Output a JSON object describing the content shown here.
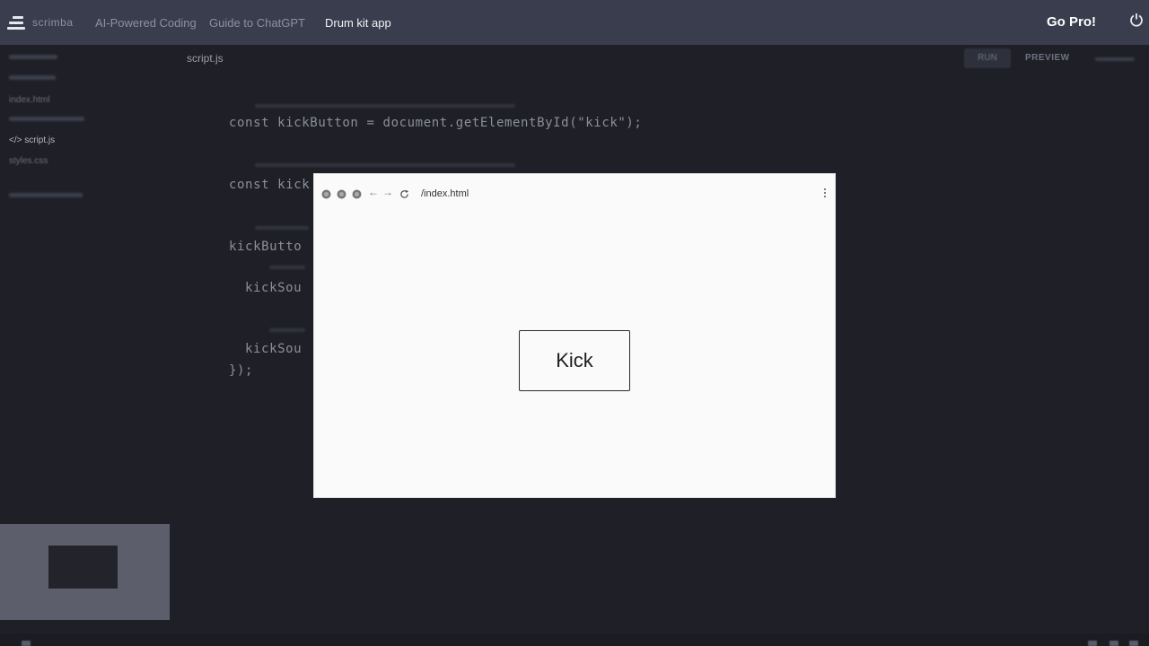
{
  "topbar": {
    "logo_text": "scrimba",
    "breadcrumbs": [
      "AI-Powered Coding",
      "Guide to ChatGPT",
      "Drum kit app"
    ],
    "go_pro": "Go Pro!"
  },
  "sidebar": {
    "files": [
      "index.html",
      "script.js",
      "styles.css"
    ],
    "selected_file": "script.js"
  },
  "editor": {
    "tab_title": "script.js",
    "run_label": "RUN",
    "preview_label": "PREVIEW",
    "lines": [
      "const kickButton = document.getElementById(\"kick\");",
      "const kick",
      "kickButto",
      "kickSou",
      "kickSou",
      "});"
    ]
  },
  "browser": {
    "url": "/index.html",
    "kick_label": "Kick"
  },
  "icons": {
    "logo": "scrimba-logo-icon",
    "power": "power-icon",
    "back": "back-arrow-icon",
    "forward": "forward-arrow-icon",
    "reload": "reload-icon",
    "menu": "kebab-menu-icon"
  },
  "colors": {
    "background": "#1f2027",
    "topbar": "#3a3d4d",
    "preview_bg": "#fafafa"
  }
}
